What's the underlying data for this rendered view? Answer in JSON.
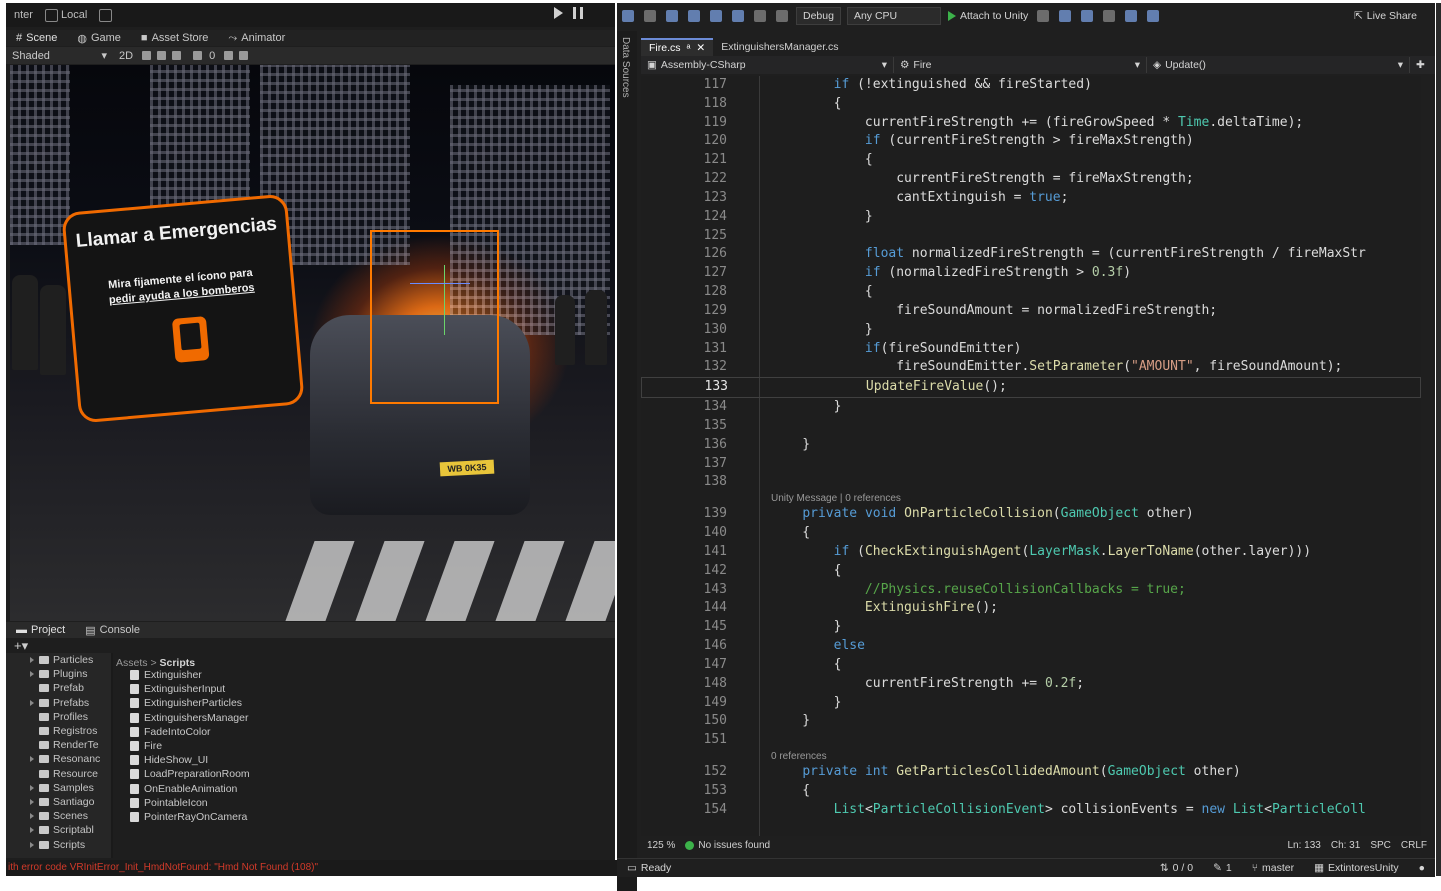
{
  "unity": {
    "toolbar": {
      "pivot": "nter",
      "local": "Local"
    },
    "tabs": [
      "Scene",
      "Game",
      "Asset Store",
      "Animator"
    ],
    "scene_toolbar": {
      "shading": "Shaded",
      "mode2d": "2D",
      "gizmo_count": "0"
    },
    "sign": {
      "title": "Llamar a Emergencias",
      "subtitle_line1": "Mira fijamente el ícono para",
      "subtitle_line2": "pedir ayuda a los bomberos"
    },
    "plate": "WB 0K35",
    "panel_tabs": [
      "Project",
      "Console"
    ],
    "add_label": "+▾",
    "tree_items": [
      {
        "label": "Particles",
        "arrow": true
      },
      {
        "label": "Plugins",
        "arrow": true
      },
      {
        "label": "Prefab",
        "arrow": false
      },
      {
        "label": "Prefabs",
        "arrow": true
      },
      {
        "label": "Profiles",
        "arrow": false
      },
      {
        "label": "Registros",
        "arrow": false
      },
      {
        "label": "RenderTe",
        "arrow": false
      },
      {
        "label": "Resonanc",
        "arrow": true
      },
      {
        "label": "Resource",
        "arrow": false
      },
      {
        "label": "Samples",
        "arrow": true
      },
      {
        "label": "Santiago",
        "arrow": true
      },
      {
        "label": "Scenes",
        "arrow": true
      },
      {
        "label": "Scriptabl",
        "arrow": true
      },
      {
        "label": "Scripts",
        "arrow": true
      }
    ],
    "breadcrumb": {
      "root": "Assets",
      "sep": ">",
      "current": "Scripts"
    },
    "files": [
      "Extinguisher",
      "ExtinguisherInput",
      "ExtinguisherParticles",
      "ExtinguishersManager",
      "FadeIntoColor",
      "Fire",
      "HideShow_UI",
      "LoadPreparationRoom",
      "OnEnableAnimation",
      "PointableIcon",
      "PointerRayOnCamera"
    ],
    "status_error": "ith error code VRInitError_Init_HmdNotFound: \"Hmd Not Found (108)\""
  },
  "vs": {
    "toolbar": {
      "config": "Debug",
      "platform": "Any CPU",
      "attach": "Attach to Unity",
      "live_share": "Live Share"
    },
    "side_label": "Data Sources",
    "tabs": [
      {
        "label": "Fire.cs",
        "active": true,
        "pin": "ᵃ",
        "close": "✕"
      },
      {
        "label": "ExtinguishersManager.cs",
        "active": false
      }
    ],
    "nav": {
      "project": "Assembly-CSharp",
      "class": "Fire",
      "member": "Update()"
    },
    "code_lines": [
      {
        "n": "117",
        "t": "        if (!extinguished && fireStarted)"
      },
      {
        "n": "118",
        "t": "        {"
      },
      {
        "n": "119",
        "t": "            currentFireStrength += (fireGrowSpeed * Time.deltaTime);"
      },
      {
        "n": "120",
        "t": "            if (currentFireStrength > fireMaxStrength)"
      },
      {
        "n": "121",
        "t": "            {"
      },
      {
        "n": "122",
        "t": "                currentFireStrength = fireMaxStrength;"
      },
      {
        "n": "123",
        "t": "                cantExtinguish = true;"
      },
      {
        "n": "124",
        "t": "            }"
      },
      {
        "n": "125",
        "t": ""
      },
      {
        "n": "126",
        "t": "            float normalizedFireStrength = (currentFireStrength / fireMaxStr"
      },
      {
        "n": "127",
        "t": "            if (normalizedFireStrength > 0.3f)"
      },
      {
        "n": "128",
        "t": "            {"
      },
      {
        "n": "129",
        "t": "                fireSoundAmount = normalizedFireStrength;"
      },
      {
        "n": "130",
        "t": "            }"
      },
      {
        "n": "131",
        "t": "            if(fireSoundEmitter)"
      },
      {
        "n": "132",
        "t": "                fireSoundEmitter.SetParameter(\"AMOUNT\", fireSoundAmount);"
      },
      {
        "n": "133",
        "t": "            UpdateFireValue();"
      },
      {
        "n": "134",
        "t": "        }"
      },
      {
        "n": "135",
        "t": ""
      },
      {
        "n": "136",
        "t": "    }"
      },
      {
        "n": "137",
        "t": ""
      },
      {
        "n": "138",
        "t": ""
      },
      {
        "lens": "Unity Message | 0 references"
      },
      {
        "n": "139",
        "t": "    private void OnParticleCollision(GameObject other)"
      },
      {
        "n": "140",
        "t": "    {"
      },
      {
        "n": "141",
        "t": "        if (CheckExtinguishAgent(LayerMask.LayerToName(other.layer)))"
      },
      {
        "n": "142",
        "t": "        {"
      },
      {
        "n": "143",
        "t": "            //Physics.reuseCollisionCallbacks = true;"
      },
      {
        "n": "144",
        "t": "            ExtinguishFire();"
      },
      {
        "n": "145",
        "t": "        }"
      },
      {
        "n": "146",
        "t": "        else"
      },
      {
        "n": "147",
        "t": "        {"
      },
      {
        "n": "148",
        "t": "            currentFireStrength += 0.2f;"
      },
      {
        "n": "149",
        "t": "        }"
      },
      {
        "n": "150",
        "t": "    }"
      },
      {
        "n": "151",
        "t": ""
      },
      {
        "lens": "0 references"
      },
      {
        "n": "152",
        "t": "    private int GetParticlesCollidedAmount(GameObject other)"
      },
      {
        "n": "153",
        "t": "    {"
      },
      {
        "n": "154",
        "t": "        List<ParticleCollisionEvent> collisionEvents = new List<ParticleColl"
      }
    ],
    "current_line": "133",
    "editor_status": {
      "zoom": "125 %",
      "issues": "No issues found",
      "ln": "Ln: 133",
      "ch": "Ch: 31",
      "spc": "SPC",
      "crlf": "CRLF"
    },
    "status": {
      "ready": "Ready",
      "errors": "0 / 0",
      "pencil": "1",
      "branch": "master",
      "repo": "ExtintoresUnity"
    }
  }
}
